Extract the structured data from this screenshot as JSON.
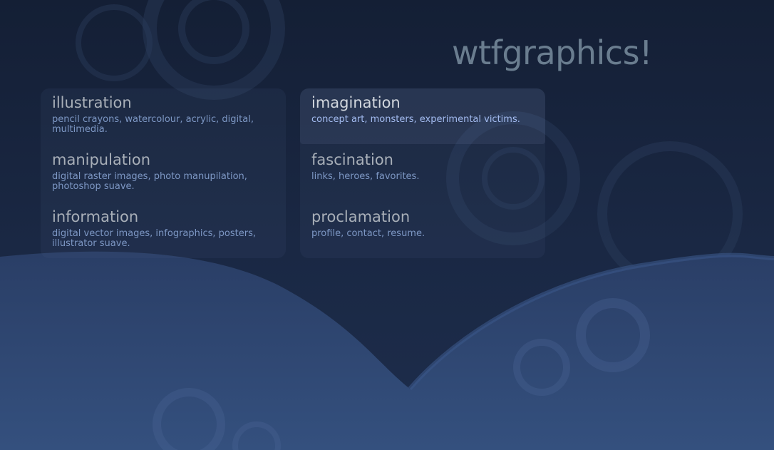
{
  "site": {
    "title": "wtfgraphics!"
  },
  "colors": {
    "background": "#16223a",
    "title": "#6a7d8f",
    "nav_heading": "#a8afb8",
    "nav_heading_active": "#d2d7de",
    "nav_desc": "#7d97c4",
    "nav_desc_active": "#a3bbf0"
  },
  "nav": {
    "left": [
      {
        "title": "illustration",
        "desc": "pencil crayons, watercolour, acrylic, digital, multimedia."
      },
      {
        "title": "manipulation",
        "desc": "digital raster images, photo manupilation, photoshop suave."
      },
      {
        "title": "information",
        "desc": "digital vector images, infographics, posters, illustrator suave."
      }
    ],
    "right": [
      {
        "title": "imagination",
        "desc": "concept art, monsters, experimental victims.",
        "active": true
      },
      {
        "title": "fascination",
        "desc": "links, heroes, favorites."
      },
      {
        "title": "proclamation",
        "desc": "profile, contact, resume."
      }
    ]
  }
}
